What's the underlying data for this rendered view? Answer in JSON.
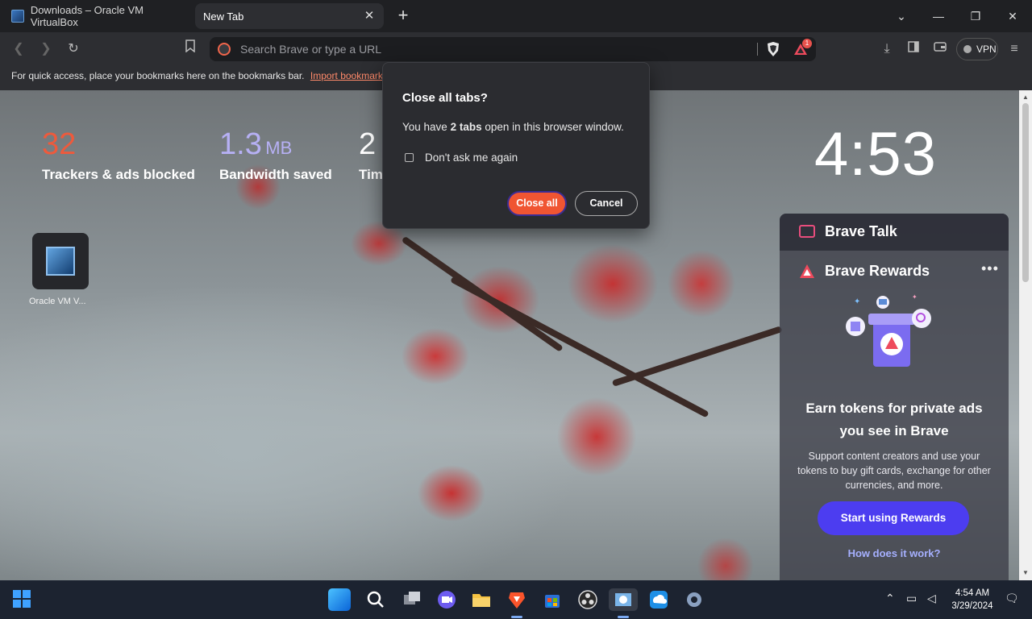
{
  "tabs": [
    {
      "label": "Downloads – Oracle VM VirtualBox"
    },
    {
      "label": "New Tab"
    }
  ],
  "toolbar": {
    "search_placeholder": "Search Brave or type a URL",
    "rewards_badge": "1",
    "vpn_label": "VPN"
  },
  "bookmarks_bar": {
    "text": "For quick access, place your bookmarks here on the bookmarks bar.",
    "import_link": "Import bookmarks..."
  },
  "stats": {
    "trackers": {
      "value": "32",
      "label": "Trackers & ads blocked",
      "color": "#ee5a3c"
    },
    "bandwidth": {
      "value": "1.3",
      "unit": "MB",
      "label": "Bandwidth saved",
      "color": "#b6b0f4"
    },
    "time": {
      "value": "2",
      "label": "Tim"
    }
  },
  "clock": "4:53",
  "shortcut": {
    "label": "Oracle VM V..."
  },
  "dialog": {
    "title": "Close all tabs?",
    "msg_prefix": "You have ",
    "msg_bold": "2 tabs",
    "msg_suffix": " open in this browser window.",
    "checkbox_label": "Don't ask me again",
    "close_all": "Close all",
    "cancel": "Cancel"
  },
  "widget": {
    "talk_label": "Brave Talk",
    "rewards_label": "Brave Rewards",
    "headline_1": "Earn tokens for private ads",
    "headline_2": "you see in Brave",
    "body": "Support content creators and use your tokens to buy gift cards, exchange for other currencies, and more.",
    "start_button": "Start using Rewards",
    "how_link": "How does it work?"
  },
  "taskbar": {
    "time": "4:54 AM",
    "date": "3/29/2024",
    "apps": [
      "windows-start",
      "search",
      "task-view",
      "meet",
      "file-explorer",
      "brave",
      "microsoft-store",
      "obs",
      "virtualbox",
      "onedrive-upload",
      "settings"
    ]
  },
  "colors": {
    "accent_orange": "#f05532",
    "rewards_purple": "#4c3df0",
    "link_blue": "#a6b0ff"
  }
}
